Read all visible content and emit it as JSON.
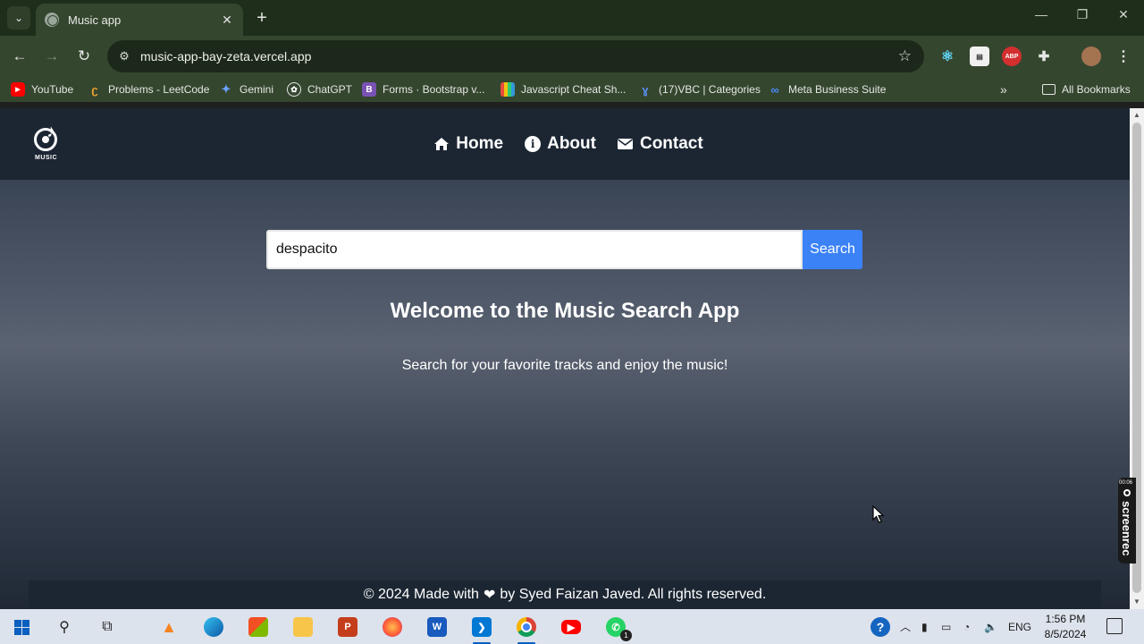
{
  "browser": {
    "tab_title": "Music app",
    "url": "music-app-bay-zeta.vercel.app",
    "bookmarks": [
      {
        "label": "YouTube",
        "icon": "youtube-icon"
      },
      {
        "label": "Problems - LeetCode",
        "icon": "leetcode-icon"
      },
      {
        "label": "Gemini",
        "icon": "gemini-icon"
      },
      {
        "label": "ChatGPT",
        "icon": "chatgpt-icon"
      },
      {
        "label": "Forms · Bootstrap v...",
        "icon": "bootstrap-icon"
      },
      {
        "label": "Javascript Cheat Sh...",
        "icon": "cheatsheet-icon"
      },
      {
        "label": "(17)VBC | Categories",
        "icon": "vbc-icon"
      },
      {
        "label": "Meta Business Suite",
        "icon": "meta-icon"
      }
    ],
    "all_bookmarks_label": "All Bookmarks"
  },
  "site": {
    "logo_text": "MUSIC",
    "nav": [
      {
        "label": "Home",
        "icon": "home-icon"
      },
      {
        "label": "About",
        "icon": "info-icon"
      },
      {
        "label": "Contact",
        "icon": "envelope-icon"
      }
    ],
    "search": {
      "value": "despacito",
      "button_label": "Search"
    },
    "welcome_title": "Welcome to the Music Search App",
    "tagline": "Search for your favorite tracks and enjoy the music!",
    "footer": {
      "before": "© 2024 Made with",
      "after": "by Syed Faizan Javed. All rights reserved."
    }
  },
  "overlay": {
    "screenrec_time": "00:06",
    "screenrec_label": "screenrec"
  },
  "taskbar": {
    "language": "ENG",
    "time": "1:56 PM",
    "date": "8/5/2024",
    "whatsapp_badge": "1"
  },
  "colors": {
    "accent": "#3b82f6",
    "nav_bg": "#1c2633",
    "chrome_bg": "#35462f"
  }
}
